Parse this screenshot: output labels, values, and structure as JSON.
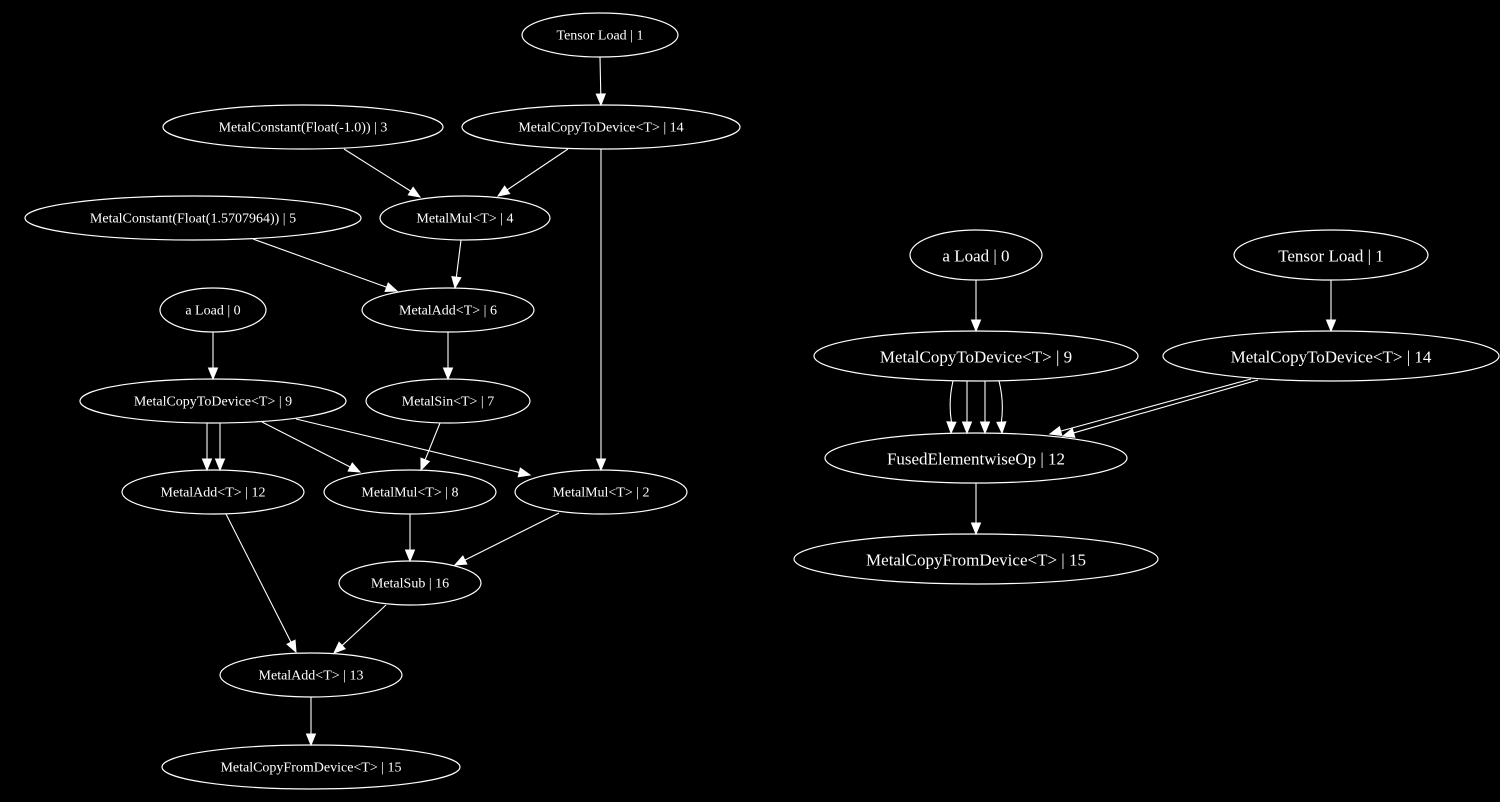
{
  "graphs": [
    {
      "id": "unfused",
      "nodes": [
        {
          "id": "L1",
          "label": "Tensor Load | 1"
        },
        {
          "id": "L14",
          "label": "MetalCopyToDevice<T> | 14"
        },
        {
          "id": "L3",
          "label": "MetalConstant(Float(-1.0)) | 3"
        },
        {
          "id": "L5",
          "label": "MetalConstant(Float(1.5707964)) | 5"
        },
        {
          "id": "L4",
          "label": "MetalMul<T> | 4"
        },
        {
          "id": "L6",
          "label": "MetalAdd<T> | 6"
        },
        {
          "id": "L0",
          "label": "a Load | 0"
        },
        {
          "id": "L9",
          "label": "MetalCopyToDevice<T> | 9"
        },
        {
          "id": "L7",
          "label": "MetalSin<T> | 7"
        },
        {
          "id": "L12",
          "label": "MetalAdd<T> | 12"
        },
        {
          "id": "L8",
          "label": "MetalMul<T> | 8"
        },
        {
          "id": "L2",
          "label": "MetalMul<T> | 2"
        },
        {
          "id": "L16",
          "label": "MetalSub | 16"
        },
        {
          "id": "L13",
          "label": "MetalAdd<T> | 13"
        },
        {
          "id": "L15",
          "label": "MetalCopyFromDevice<T> | 15"
        }
      ],
      "edges": [
        [
          "L1",
          "L14"
        ],
        [
          "L3",
          "L4"
        ],
        [
          "L14",
          "L4"
        ],
        [
          "L14",
          "L2"
        ],
        [
          "L5",
          "L6"
        ],
        [
          "L4",
          "L6"
        ],
        [
          "L6",
          "L7"
        ],
        [
          "L0",
          "L9"
        ],
        [
          "L9",
          "L12"
        ],
        [
          "L9",
          "L12"
        ],
        [
          "L9",
          "L8"
        ],
        [
          "L9",
          "L2"
        ],
        [
          "L7",
          "L8"
        ],
        [
          "L8",
          "L16"
        ],
        [
          "L2",
          "L16"
        ],
        [
          "L12",
          "L13"
        ],
        [
          "L16",
          "L13"
        ],
        [
          "L13",
          "L15"
        ]
      ]
    },
    {
      "id": "fused",
      "nodes": [
        {
          "id": "R0",
          "label": "a Load | 0"
        },
        {
          "id": "R1",
          "label": "Tensor Load | 1"
        },
        {
          "id": "R9",
          "label": "MetalCopyToDevice<T> | 9"
        },
        {
          "id": "R14",
          "label": "MetalCopyToDevice<T> | 14"
        },
        {
          "id": "R12",
          "label": "FusedElementwiseOp | 12"
        },
        {
          "id": "R15",
          "label": "MetalCopyFromDevice<T> | 15"
        }
      ],
      "edges": [
        [
          "R0",
          "R9"
        ],
        [
          "R1",
          "R14"
        ],
        [
          "R9",
          "R12"
        ],
        [
          "R9",
          "R12"
        ],
        [
          "R9",
          "R12"
        ],
        [
          "R9",
          "R12"
        ],
        [
          "R14",
          "R12"
        ],
        [
          "R14",
          "R12"
        ],
        [
          "R12",
          "R15"
        ]
      ]
    }
  ],
  "colors": {
    "background": "#000000",
    "stroke": "#ffffff",
    "text": "#ffffff"
  }
}
